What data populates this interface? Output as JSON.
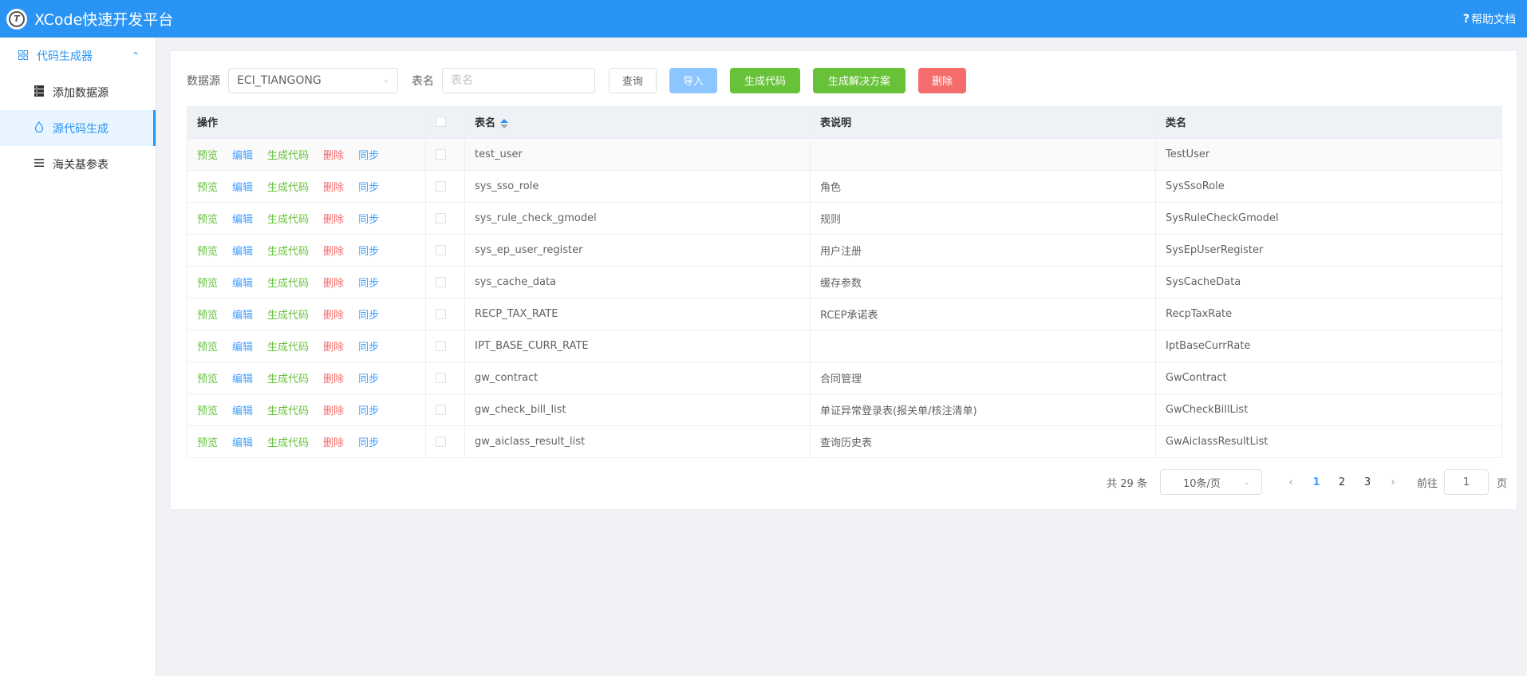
{
  "header": {
    "title": "XCode快速开发平台",
    "logo_letter": "T",
    "help_label": "帮助文档"
  },
  "sidebar": {
    "group_label": "代码生成器",
    "items": [
      {
        "label": "添加数据源",
        "icon": "server-icon"
      },
      {
        "label": "源代码生成",
        "icon": "droplet-icon",
        "active": true
      },
      {
        "label": "海关基参表",
        "icon": "list-icon"
      }
    ]
  },
  "toolbar": {
    "datasource_label": "数据源",
    "datasource_value": "ECI_TIANGONG",
    "tablename_label": "表名",
    "tablename_placeholder": "表名",
    "query_label": "查询",
    "import_label": "导入",
    "gen_code_label": "生成代码",
    "gen_solution_label": "生成解决方案",
    "delete_label": "删除"
  },
  "table": {
    "headers": {
      "actions": "操作",
      "table_name": "表名",
      "description": "表说明",
      "class_name": "类名"
    },
    "action_labels": {
      "preview": "预览",
      "edit": "编辑",
      "generate": "生成代码",
      "delete": "删除",
      "sync": "同步"
    },
    "rows": [
      {
        "table_name": "test_user",
        "description": "",
        "class_name": "TestUser"
      },
      {
        "table_name": "sys_sso_role",
        "description": "角色",
        "class_name": "SysSsoRole"
      },
      {
        "table_name": "sys_rule_check_gmodel",
        "description": "规则",
        "class_name": "SysRuleCheckGmodel"
      },
      {
        "table_name": "sys_ep_user_register",
        "description": "用户注册",
        "class_name": "SysEpUserRegister"
      },
      {
        "table_name": "sys_cache_data",
        "description": "缓存参数",
        "class_name": "SysCacheData"
      },
      {
        "table_name": "RECP_TAX_RATE",
        "description": "RCEP承诺表",
        "class_name": "RecpTaxRate"
      },
      {
        "table_name": "IPT_BASE_CURR_RATE",
        "description": "",
        "class_name": "IptBaseCurrRate"
      },
      {
        "table_name": "gw_contract",
        "description": "合同管理",
        "class_name": "GwContract"
      },
      {
        "table_name": "gw_check_bill_list",
        "description": "单证异常登录表(报关单/核注清单)",
        "class_name": "GwCheckBillList"
      },
      {
        "table_name": "gw_aiclass_result_list",
        "description": "查询历史表",
        "class_name": "GwAiclassResultList"
      }
    ]
  },
  "pagination": {
    "total_text": "共 29 条",
    "page_size": "10条/页",
    "pages": [
      "1",
      "2",
      "3"
    ],
    "current_page": "1",
    "goto_label": "前往",
    "goto_value": "1",
    "page_suffix": "页"
  },
  "colors": {
    "primary": "#2a94f4",
    "success": "#67c23a",
    "danger": "#f56c6c",
    "link": "#409eff"
  }
}
